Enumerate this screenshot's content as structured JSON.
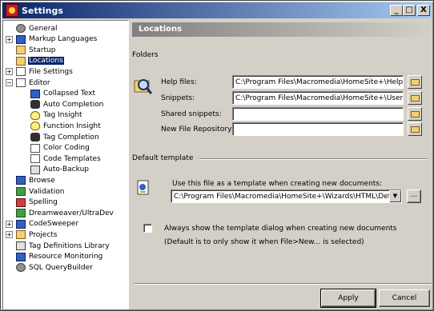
{
  "window": {
    "title": "Settings"
  },
  "titlebar_buttons": {
    "minimize": "_",
    "maximize": "□",
    "close": "X"
  },
  "tree": [
    {
      "label": "General",
      "icon": "gear-icon",
      "expander": ""
    },
    {
      "label": "Markup Languages",
      "icon": "markup-icon",
      "expander": "+"
    },
    {
      "label": "Startup",
      "icon": "folder-icon",
      "expander": ""
    },
    {
      "label": "Locations",
      "icon": "locations-icon",
      "expander": "",
      "selected": true
    },
    {
      "label": "File Settings",
      "icon": "file-icon",
      "expander": "+"
    },
    {
      "label": "Editor",
      "icon": "page-icon",
      "expander": "−"
    },
    {
      "label": "Collapsed Text",
      "icon": "collapse-icon",
      "child": true
    },
    {
      "label": "Auto Completion",
      "icon": "car-icon",
      "child": true
    },
    {
      "label": "Tag Insight",
      "icon": "bulb-icon",
      "child": true
    },
    {
      "label": "Function Insight",
      "icon": "bulb-icon",
      "child": true
    },
    {
      "label": "Tag Completion",
      "icon": "car-icon",
      "child": true
    },
    {
      "label": "Color Coding",
      "icon": "page-icon",
      "child": true
    },
    {
      "label": "Code Templates",
      "icon": "page-icon",
      "child": true
    },
    {
      "label": "Auto-Backup",
      "icon": "backup-icon",
      "child": true
    },
    {
      "label": "Browse",
      "icon": "browse-icon",
      "expander": ""
    },
    {
      "label": "Validation",
      "icon": "validation-icon",
      "expander": ""
    },
    {
      "label": "Spelling",
      "icon": "spelling-icon",
      "expander": ""
    },
    {
      "label": "Dreamweaver/UltraDev",
      "icon": "dreamweaver-icon",
      "expander": ""
    },
    {
      "label": "CodeSweeper",
      "icon": "codesweeper-icon",
      "expander": "+"
    },
    {
      "label": "Projects",
      "icon": "projects-icon",
      "expander": "+"
    },
    {
      "label": "Tag Definitions Library",
      "icon": "tag-library-icon",
      "expander": ""
    },
    {
      "label": "Resource Monitoring",
      "icon": "monitoring-icon",
      "expander": ""
    },
    {
      "label": "SQL QueryBuilder",
      "icon": "sql-icon",
      "expander": ""
    }
  ],
  "panel": {
    "title": "Locations",
    "folders_section": "Folders",
    "fields": [
      {
        "label": "Help files:",
        "value": "C:\\Program Files\\Macromedia\\HomeSite+\\Help\\"
      },
      {
        "label": "Snippets:",
        "value": "C:\\Program Files\\Macromedia\\HomeSite+\\UserData"
      },
      {
        "label": "Shared snippets:",
        "value": ""
      },
      {
        "label": "New File Repository:",
        "value": ""
      }
    ],
    "template_section": "Default template",
    "template_prompt": "Use this file as a template when creating new documents:",
    "template_value": "C:\\Program Files\\Macromedia\\HomeSite+\\Wizards\\HTML\\Default",
    "browse_label": "...",
    "always_show_label": "Always show the template dialog when creating new documents",
    "always_show_checked": false,
    "note": "(Default is to only show it when File>New... is selected)"
  },
  "buttons": {
    "apply": "Apply",
    "cancel": "Cancel"
  },
  "colors": {
    "titlebar": "#0a246a",
    "selection": "#0a246a",
    "face": "#d4d0c8"
  }
}
